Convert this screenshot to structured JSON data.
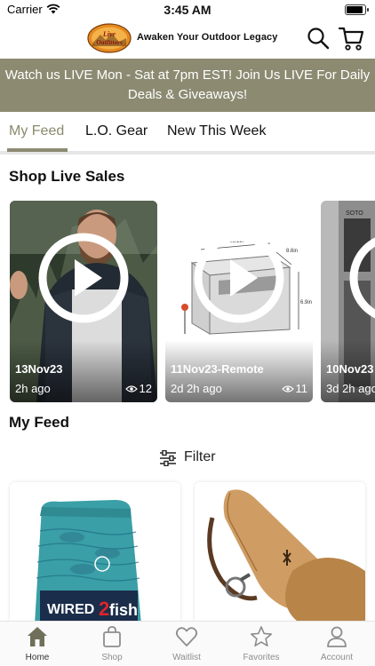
{
  "status": {
    "carrier": "Carrier",
    "time": "3:45 AM"
  },
  "header": {
    "logo_text": "Live Outfitters",
    "tagline": "Awaken Your Outdoor Legacy"
  },
  "banner": {
    "text": "Watch us LIVE Mon - Sat at 7pm EST! Join Us LIVE For Daily Deals & Giveaways!"
  },
  "tabs": [
    {
      "label": "My Feed",
      "active": true
    },
    {
      "label": "L.O. Gear",
      "active": false
    },
    {
      "label": "New This Week",
      "active": false
    }
  ],
  "live_sales": {
    "title": "Shop Live Sales",
    "cards": [
      {
        "title": "13Nov23",
        "time": "2h ago",
        "views": "12",
        "icon": "play-icon"
      },
      {
        "title": "11Nov23-Remote",
        "time": "2d 2h ago",
        "views": "11",
        "icon": "play-icon"
      },
      {
        "title": "10Nov23",
        "time": "3d 2h ago",
        "views": "",
        "icon": "play-icon"
      }
    ]
  },
  "feed": {
    "title": "My Feed",
    "filter_label": "Filter",
    "products": [
      {
        "brand_text": "WIRED2fish"
      },
      {
        "brand_text": ""
      }
    ]
  },
  "bottom_nav": [
    {
      "label": "Home",
      "icon": "home-icon",
      "active": true
    },
    {
      "label": "Shop",
      "icon": "bag-icon",
      "active": false
    },
    {
      "label": "Waitlist",
      "icon": "heart-icon",
      "active": false
    },
    {
      "label": "Favorites",
      "icon": "star-icon",
      "active": false
    },
    {
      "label": "Account",
      "icon": "person-icon",
      "active": false
    }
  ],
  "colors": {
    "brand_olive": "#8c8b72",
    "active_tab_text": "#8a8a6e",
    "nav_inactive": "#8d8d8d"
  }
}
